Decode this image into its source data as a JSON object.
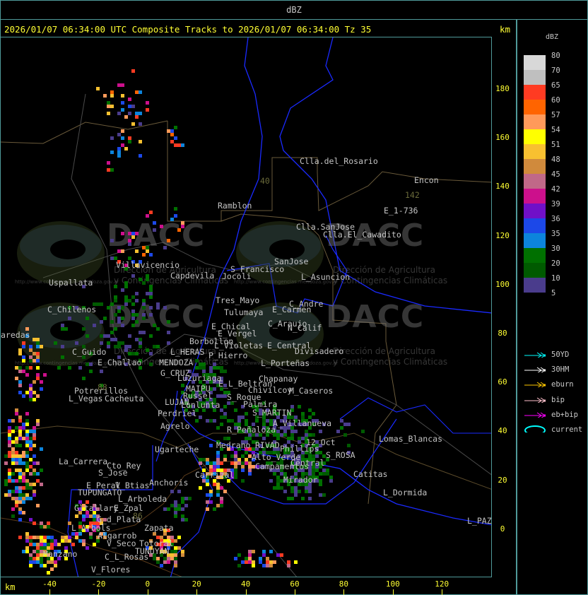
{
  "header": {
    "title": "dBZ"
  },
  "subtitle": "2026/01/07 06:34:00 UTC Composite Tracks to 2026/01/07 06:34:00 Tz 35",
  "axis": {
    "unit": "km",
    "x_ticks": [
      "-40",
      "-20",
      "0",
      "20",
      "40",
      "60",
      "80",
      "100",
      "120"
    ],
    "y_ticks": [
      "180",
      "160",
      "140",
      "120",
      "100",
      "80",
      "60",
      "40",
      "20",
      "0"
    ]
  },
  "legend": {
    "title": "dBZ",
    "levels": [
      {
        "label": "80",
        "color": "#d8d8d8"
      },
      {
        "label": "70",
        "color": "#bfbfbf"
      },
      {
        "label": "65",
        "color": "#ff3b22"
      },
      {
        "label": "60",
        "color": "#ff6400"
      },
      {
        "label": "57",
        "color": "#ff9a5a"
      },
      {
        "label": "54",
        "color": "#ffff00"
      },
      {
        "label": "51",
        "color": "#f8c030"
      },
      {
        "label": "48",
        "color": "#d08a3c"
      },
      {
        "label": "45",
        "color": "#c06888"
      },
      {
        "label": "42",
        "color": "#cc108c"
      },
      {
        "label": "39",
        "color": "#7010c8"
      },
      {
        "label": "36",
        "color": "#1c48e8"
      },
      {
        "label": "35",
        "color": "#0c84dc"
      },
      {
        "label": "30",
        "color": "#007000"
      },
      {
        "label": "20",
        "color": "#005a00"
      },
      {
        "label": "10",
        "color": "#4a3c8c"
      }
    ],
    "bottom_label": "5",
    "tracks": [
      {
        "label": "50YD",
        "color": "#00ffff",
        "icon": "arrow-icon"
      },
      {
        "label": "30HM",
        "color": "#ffffff",
        "icon": "arrow-icon"
      },
      {
        "label": "eburn",
        "color": "#ffc800",
        "icon": "arrow-icon"
      },
      {
        "label": "bip",
        "color": "#ffc0cb",
        "icon": "arrow-icon"
      },
      {
        "label": "eb+bip",
        "color": "#ff00ff",
        "icon": "arrow-icon"
      },
      {
        "label": "current",
        "color": "#00ffff",
        "icon": "ellipse-icon"
      }
    ]
  },
  "watermark": {
    "logo_text": "DACC",
    "line1": "Dirección de Agricultura",
    "line2": "y Contingencias Climáticas",
    "url": "http://www.contingencias.mendoza.gov.ar"
  },
  "places": [
    "Clla.del_Rosario",
    "Encon",
    "142",
    "E_1-736",
    "Ramblon",
    "Clla.SanJose",
    "Clla.El_Cawadito",
    "Villavicencio",
    "Capdevila",
    "S_Francisco",
    "Jocoli",
    "SanJose",
    "L_Asuncion",
    "Uspallata",
    "Tres_Mayo",
    "Tulumaya",
    "C_Andre",
    "E_Carmen",
    "C_Chilenos",
    "E_Chical",
    "E_Vergel",
    "C_Araujo",
    "N_Calif",
    "aredas",
    "L_Violetas",
    "Borbollon",
    "E_Central",
    "Divisadero",
    "C_Guido",
    "L_HERAS",
    "E_Challao",
    "MENDOZA",
    "P_Hierro",
    "L_Porteñas",
    "G_CRUZ",
    "Luzuriaga",
    "Chapanay",
    "E_L_Beltran",
    "Potrerillos",
    "Chivilcoy",
    "M_Caseros",
    "L_Vegas",
    "Cacheuta",
    "MAIPU",
    "Russel",
    "S_Roque",
    "Palmira",
    "LUJAN",
    "Lunlunta",
    "S_MARTIN",
    "Perdriel",
    "A_Villanueva",
    "Agrelo",
    "R_Peñaloza",
    "Ugarteche",
    "12_Oct",
    "Lomas_Blancas",
    "Medrano",
    "RIVAD",
    "Phillips",
    "La_Carrera",
    "Cto_Rey",
    "S_Jose",
    "Alto_Verde",
    "S_ROSA",
    "Central",
    "Catitas",
    "Campamentos",
    "Anchoris",
    "Carrizal",
    "Mirador",
    "E_Peral",
    "V_Btias",
    "TUPUNGATO",
    "L_Dormida",
    "L_Arboleda",
    "Gltallary",
    "E_Zpal",
    "G_d_Plata",
    "L_PAZ",
    "L_Arbols",
    "Zapata",
    "Algarrob",
    "V_Seco",
    "Totoral",
    "TUNUYAN",
    "Manzano",
    "C_L_Rosas",
    "V_Flores",
    "88",
    "40",
    "86"
  ]
}
